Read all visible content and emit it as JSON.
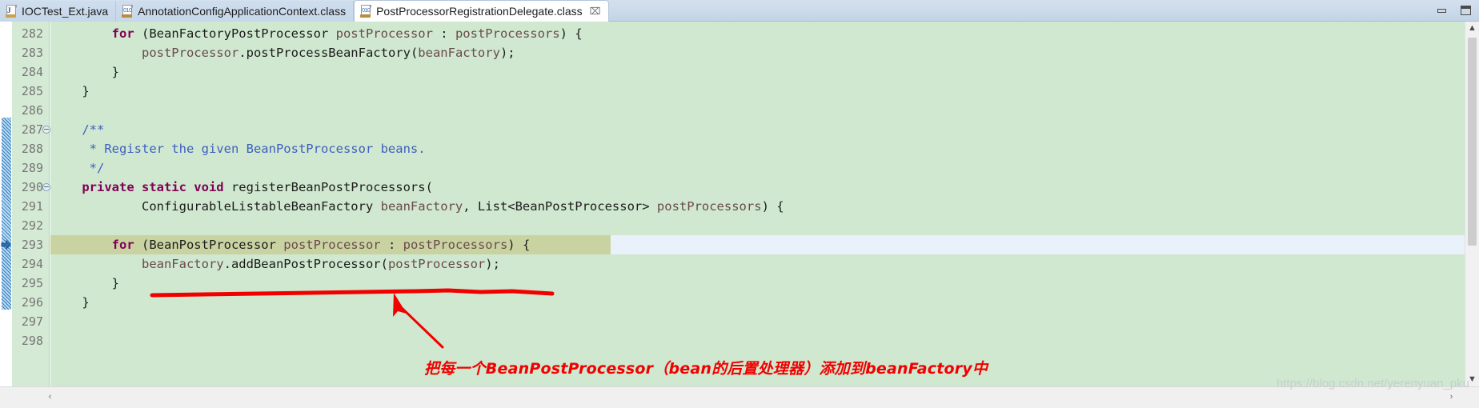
{
  "window": {
    "minimize_label": "Minimize",
    "maximize_label": "Maximize"
  },
  "tabs": [
    {
      "label": "IOCTest_Ext.java",
      "icon": "java-file-icon",
      "active": false,
      "closable": false
    },
    {
      "label": "AnnotationConfigApplicationContext.class",
      "icon": "class-file-icon",
      "active": false,
      "closable": false
    },
    {
      "label": "PostProcessorRegistrationDelegate.class",
      "icon": "class-file-icon",
      "active": true,
      "closable": true,
      "close_glyph": "⌧"
    }
  ],
  "editor": {
    "current_line": 293,
    "lines": [
      {
        "num": "282",
        "fold": false,
        "changed": false,
        "tokens": [
          {
            "t": "        ",
            "c": "plain"
          },
          {
            "t": "for",
            "c": "kw"
          },
          {
            "t": " (BeanFactoryPostProcessor ",
            "c": "plain"
          },
          {
            "t": "postProcessor",
            "c": "var"
          },
          {
            "t": " : ",
            "c": "plain"
          },
          {
            "t": "postProcessors",
            "c": "var"
          },
          {
            "t": ") {",
            "c": "plain"
          }
        ]
      },
      {
        "num": "283",
        "fold": false,
        "changed": false,
        "tokens": [
          {
            "t": "            ",
            "c": "plain"
          },
          {
            "t": "postProcessor",
            "c": "var"
          },
          {
            "t": ".postProcessBeanFactory(",
            "c": "plain"
          },
          {
            "t": "beanFactory",
            "c": "var"
          },
          {
            "t": ");",
            "c": "plain"
          }
        ]
      },
      {
        "num": "284",
        "fold": false,
        "changed": false,
        "tokens": [
          {
            "t": "        }",
            "c": "plain"
          }
        ]
      },
      {
        "num": "285",
        "fold": false,
        "changed": false,
        "tokens": [
          {
            "t": "    }",
            "c": "plain"
          }
        ]
      },
      {
        "num": "286",
        "fold": false,
        "changed": false,
        "tokens": [
          {
            "t": "",
            "c": "plain"
          }
        ]
      },
      {
        "num": "287",
        "fold": true,
        "changed": true,
        "tokens": [
          {
            "t": "    /**",
            "c": "cmt"
          }
        ]
      },
      {
        "num": "288",
        "fold": false,
        "changed": true,
        "tokens": [
          {
            "t": "     * Register the given BeanPostProcessor beans.",
            "c": "cmt"
          }
        ]
      },
      {
        "num": "289",
        "fold": false,
        "changed": true,
        "tokens": [
          {
            "t": "     */",
            "c": "cmt"
          }
        ]
      },
      {
        "num": "290",
        "fold": true,
        "changed": true,
        "tokens": [
          {
            "t": "    ",
            "c": "plain"
          },
          {
            "t": "private static void",
            "c": "kw"
          },
          {
            "t": " registerBeanPostProcessors(",
            "c": "plain"
          }
        ]
      },
      {
        "num": "291",
        "fold": false,
        "changed": true,
        "tokens": [
          {
            "t": "            ConfigurableListableBeanFactory ",
            "c": "plain"
          },
          {
            "t": "beanFactory",
            "c": "var"
          },
          {
            "t": ", List<BeanPostProcessor> ",
            "c": "plain"
          },
          {
            "t": "postProcessors",
            "c": "var"
          },
          {
            "t": ") {",
            "c": "plain"
          }
        ]
      },
      {
        "num": "292",
        "fold": false,
        "changed": true,
        "tokens": [
          {
            "t": "",
            "c": "plain"
          }
        ]
      },
      {
        "num": "293",
        "fold": false,
        "changed": true,
        "tokens": [
          {
            "t": "        ",
            "c": "plain"
          },
          {
            "t": "for",
            "c": "kw"
          },
          {
            "t": " (BeanPostProcessor ",
            "c": "plain"
          },
          {
            "t": "postProcessor",
            "c": "var"
          },
          {
            "t": " : ",
            "c": "plain"
          },
          {
            "t": "postProcessors",
            "c": "var"
          },
          {
            "t": ") {",
            "c": "plain"
          }
        ]
      },
      {
        "num": "294",
        "fold": false,
        "changed": true,
        "tokens": [
          {
            "t": "            ",
            "c": "plain"
          },
          {
            "t": "beanFactory",
            "c": "var"
          },
          {
            "t": ".addBeanPostProcessor(",
            "c": "plain"
          },
          {
            "t": "postProcessor",
            "c": "var"
          },
          {
            "t": ");",
            "c": "plain"
          }
        ]
      },
      {
        "num": "295",
        "fold": false,
        "changed": true,
        "tokens": [
          {
            "t": "        }",
            "c": "plain"
          }
        ]
      },
      {
        "num": "296",
        "fold": false,
        "changed": true,
        "tokens": [
          {
            "t": "    }",
            "c": "plain"
          }
        ]
      },
      {
        "num": "297",
        "fold": false,
        "changed": false,
        "tokens": [
          {
            "t": "",
            "c": "plain"
          }
        ]
      },
      {
        "num": "298",
        "fold": false,
        "changed": false,
        "tokens": [
          {
            "t": "",
            "c": "plain"
          }
        ]
      }
    ]
  },
  "scrollbars": {
    "up_glyph": "▲",
    "down_glyph": "▼",
    "left_glyph": "‹",
    "right_glyph": "›"
  },
  "annotation": {
    "note_text": "把每一个BeanPostProcessor（bean的后置处理器）添加到beanFactory中",
    "color": "#f20000"
  },
  "watermark": {
    "text": "https://blog.csdn.net/yerenyuan_pku"
  },
  "colors": {
    "editor_background": "#cfe8cf",
    "gutter_background": "#d5ead5",
    "current_line": "#c9d3a2",
    "current_line_rest": "#e9f1fb",
    "keyword": "#7f0055",
    "comment": "#3f5fbf",
    "variable": "#6a4a4a",
    "tabbar": "#cbdaea"
  }
}
